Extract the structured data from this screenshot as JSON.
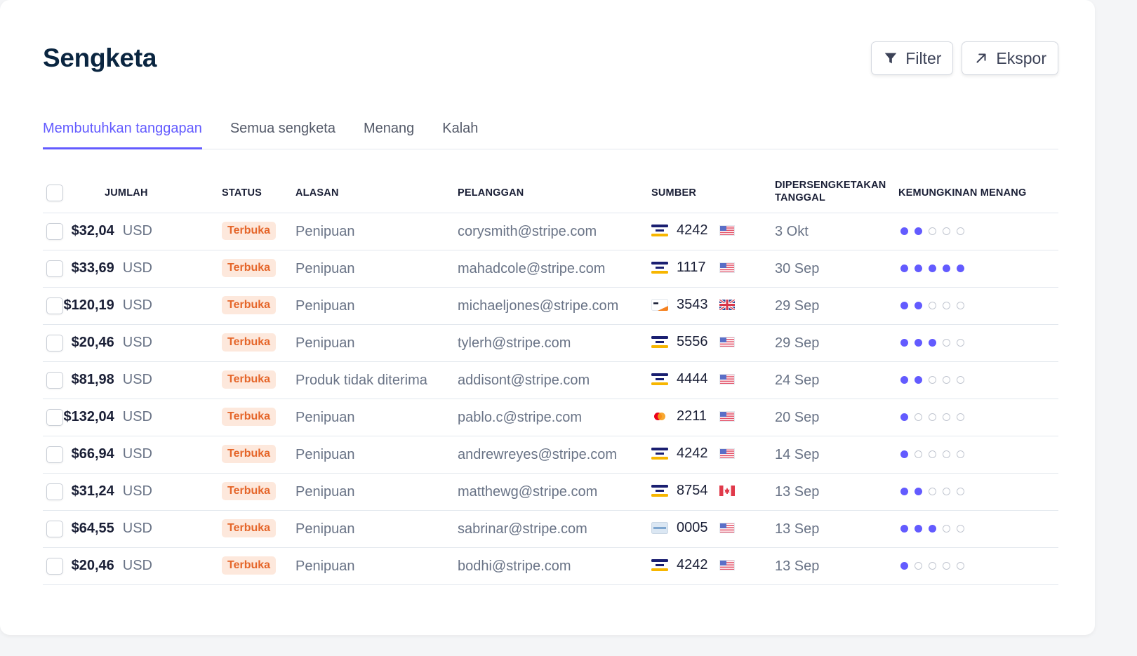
{
  "page": {
    "title": "Sengketa"
  },
  "toolbar": {
    "filter_label": "Filter",
    "export_label": "Ekspor"
  },
  "tabs": [
    {
      "label": "Membutuhkan tanggapan",
      "active": true
    },
    {
      "label": "Semua sengketa",
      "active": false
    },
    {
      "label": "Menang",
      "active": false
    },
    {
      "label": "Kalah",
      "active": false
    }
  ],
  "columns": {
    "amount": "JUMLAH",
    "status": "STATUS",
    "reason": "ALASAN",
    "customer": "PELANGGAN",
    "source": "SUMBER",
    "disputed_date_line1": "DIPERSENGKETAKAN",
    "disputed_date_line2": "TANGGAL",
    "win_likelihood": "KEMUNGKINAN MENANG"
  },
  "colors": {
    "accent": "#635bff",
    "badge_bg": "#fde8dc",
    "badge_text": "#e5662a"
  },
  "win_max": 5,
  "rows": [
    {
      "amount": "$32,04",
      "currency": "USD",
      "status": "Terbuka",
      "reason": "Penipuan",
      "customer": "corysmith@stripe.com",
      "card_brand": "visa",
      "last4": "4242",
      "country": "us",
      "date": "3 Okt",
      "win": 2
    },
    {
      "amount": "$33,69",
      "currency": "USD",
      "status": "Terbuka",
      "reason": "Penipuan",
      "customer": "mahadcole@stripe.com",
      "card_brand": "visa",
      "last4": "1117",
      "country": "us",
      "date": "30 Sep",
      "win": 5
    },
    {
      "amount": "$120,19",
      "currency": "USD",
      "status": "Terbuka",
      "reason": "Penipuan",
      "customer": "michaeljones@stripe.com",
      "card_brand": "discover",
      "last4": "3543",
      "country": "gb",
      "date": "29 Sep",
      "win": 2
    },
    {
      "amount": "$20,46",
      "currency": "USD",
      "status": "Terbuka",
      "reason": "Penipuan",
      "customer": "tylerh@stripe.com",
      "card_brand": "visa",
      "last4": "5556",
      "country": "us",
      "date": "29 Sep",
      "win": 3
    },
    {
      "amount": "$81,98",
      "currency": "USD",
      "status": "Terbuka",
      "reason": "Produk tidak diterima",
      "customer": "addisont@stripe.com",
      "card_brand": "visa",
      "last4": "4444",
      "country": "us",
      "date": "24 Sep",
      "win": 2
    },
    {
      "amount": "$132,04",
      "currency": "USD",
      "status": "Terbuka",
      "reason": "Penipuan",
      "customer": "pablo.c@stripe.com",
      "card_brand": "mastercard",
      "last4": "2211",
      "country": "us",
      "date": "20 Sep",
      "win": 1
    },
    {
      "amount": "$66,94",
      "currency": "USD",
      "status": "Terbuka",
      "reason": "Penipuan",
      "customer": "andrewreyes@stripe.com",
      "card_brand": "visa",
      "last4": "4242",
      "country": "us",
      "date": "14 Sep",
      "win": 1
    },
    {
      "amount": "$31,24",
      "currency": "USD",
      "status": "Terbuka",
      "reason": "Penipuan",
      "customer": "matthewg@stripe.com",
      "card_brand": "visa",
      "last4": "8754",
      "country": "ca",
      "date": "13 Sep",
      "win": 2
    },
    {
      "amount": "$64,55",
      "currency": "USD",
      "status": "Terbuka",
      "reason": "Penipuan",
      "customer": "sabrinar@stripe.com",
      "card_brand": "amex",
      "last4": "0005",
      "country": "us",
      "date": "13 Sep",
      "win": 3
    },
    {
      "amount": "$20,46",
      "currency": "USD",
      "status": "Terbuka",
      "reason": "Penipuan",
      "customer": "bodhi@stripe.com",
      "card_brand": "visa",
      "last4": "4242",
      "country": "us",
      "date": "13 Sep",
      "win": 1
    }
  ]
}
